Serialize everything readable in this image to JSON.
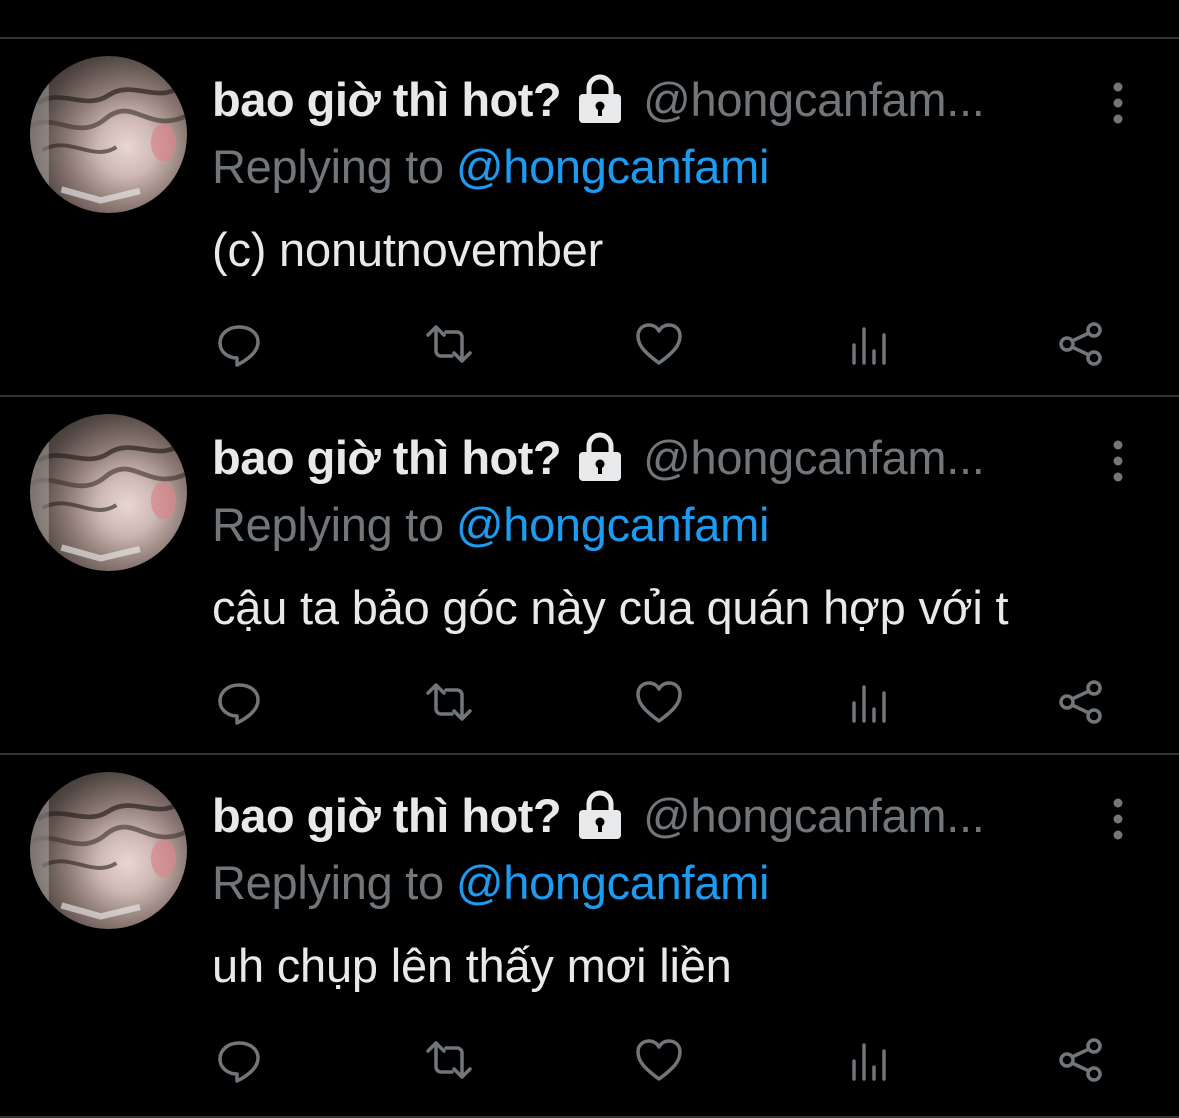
{
  "colors": {
    "background": "#000000",
    "divider": "#2f3336",
    "primary_text": "#e7e9ea",
    "secondary_text": "#71767b",
    "link": "#1d9bf0"
  },
  "tweets": [
    {
      "display_name": "bao giờ thì hot?",
      "handle": "@hongcanfam...",
      "reply_prefix": "Replying to",
      "reply_to": "@hongcanfami",
      "text": "(c) nonutnovember",
      "protected_icon": "lock-icon",
      "actions": [
        "reply-icon",
        "retweet-icon",
        "like-icon",
        "views-icon",
        "share-icon"
      ]
    },
    {
      "display_name": "bao giờ thì hot?",
      "handle": "@hongcanfam...",
      "reply_prefix": "Replying to",
      "reply_to": "@hongcanfami",
      "text": "cậu ta bảo góc này của quán hợp với t",
      "protected_icon": "lock-icon",
      "actions": [
        "reply-icon",
        "retweet-icon",
        "like-icon",
        "views-icon",
        "share-icon"
      ]
    },
    {
      "display_name": "bao giờ thì hot?",
      "handle": "@hongcanfam...",
      "reply_prefix": "Replying to",
      "reply_to": "@hongcanfami",
      "text": "uh chụp lên thấy mơi liền",
      "protected_icon": "lock-icon",
      "actions": [
        "reply-icon",
        "retweet-icon",
        "like-icon",
        "views-icon",
        "share-icon"
      ]
    }
  ]
}
